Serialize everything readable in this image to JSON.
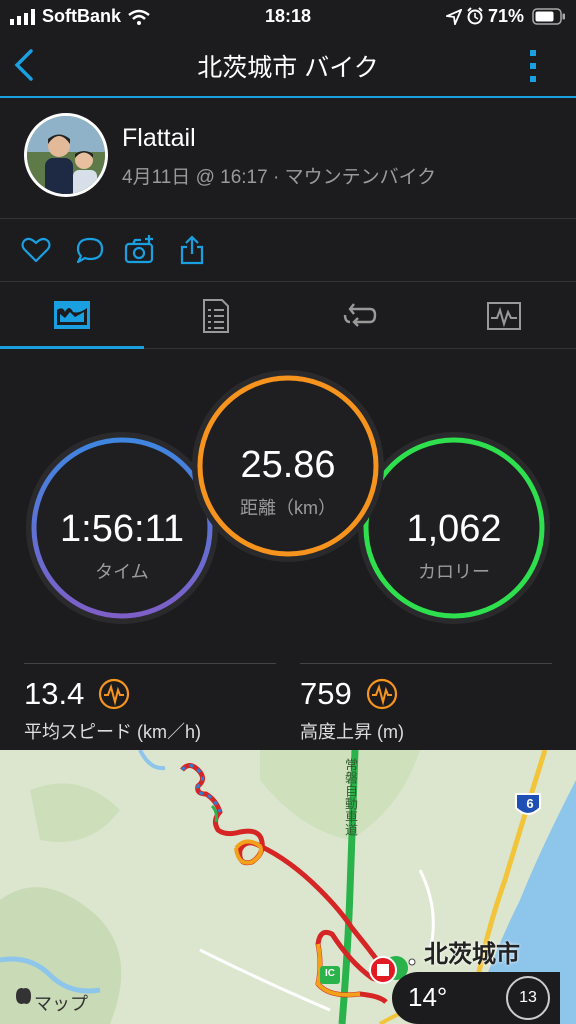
{
  "status_bar": {
    "carrier": "SoftBank",
    "time": "18:18",
    "battery": "71%"
  },
  "header": {
    "title": "北茨城市 バイク"
  },
  "profile": {
    "name": "Flattail",
    "meta": "4月11日 @ 16:17 · マウンテンバイク"
  },
  "actions": [
    "heart-icon",
    "comment-icon",
    "camera-add-icon",
    "share-icon"
  ],
  "tabs": [
    "overview-icon",
    "details-list-icon",
    "laps-icon",
    "chart-icon"
  ],
  "rings": {
    "time": {
      "value": "1:56:11",
      "label": "タイム"
    },
    "distance": {
      "value": "25.86",
      "label": "距離（km）"
    },
    "calories": {
      "value": "1,062",
      "label": "カロリー"
    }
  },
  "metrics": {
    "speed": {
      "value": "13.4",
      "label": "平均スピード (km／h)"
    },
    "ascent": {
      "value": "759",
      "label": "高度上昇 (m)"
    }
  },
  "map": {
    "city": "北茨城市",
    "attribution": "マップ",
    "expressway": "常磐自動車道",
    "route_number": "6",
    "ic_badge": "IC",
    "temperature": "14°",
    "wind": "13"
  },
  "colors": {
    "accent": "#1a9fe0",
    "time_ring": "#5b6fd6",
    "distance_ring": "#f7941d",
    "calories_ring": "#2ee04d"
  }
}
